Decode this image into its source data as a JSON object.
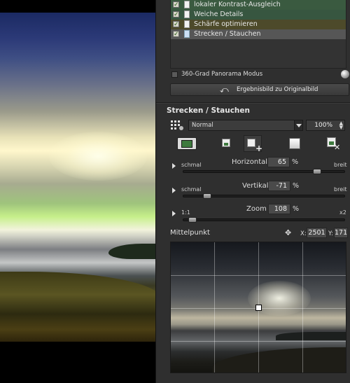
{
  "filter_list": {
    "items": [
      {
        "label": "lokaler Kontrast-Ausgleich",
        "checked": true,
        "icon": "document-icon"
      },
      {
        "label": "Weiche Details",
        "checked": true,
        "icon": "document-icon"
      },
      {
        "label": "Schärfe optimieren",
        "checked": true,
        "icon": "document-icon"
      },
      {
        "label": "Strecken / Stauchen",
        "checked": true,
        "icon": "document-icon-blue",
        "selected": true
      }
    ]
  },
  "panorama": {
    "label": "360-Grad Panorama Modus",
    "checked": false
  },
  "apply_button": {
    "label": "Ergebnisbild zu Originalbild"
  },
  "section": {
    "title": "Strecken / Stauchen",
    "blend_mode": "Normal",
    "opacity": "100%"
  },
  "sliders": {
    "horizontal": {
      "label": "Horizontal",
      "value": "65",
      "unit": "%",
      "min_label": "schmal",
      "max_label": "breit",
      "position": 0.85
    },
    "vertical": {
      "label": "Vertikal",
      "value": "-71",
      "unit": "%",
      "min_label": "schmal",
      "max_label": "breit",
      "position": 0.13
    },
    "zoom": {
      "label": "Zoom",
      "value": "108",
      "unit": "%",
      "min_label": "1:1",
      "max_label": "x2",
      "position": 0.03
    }
  },
  "center": {
    "title": "Mittelpunkt",
    "x_label": "X:",
    "x_value": "2501",
    "y_label": "Y:",
    "y_value": "171"
  }
}
